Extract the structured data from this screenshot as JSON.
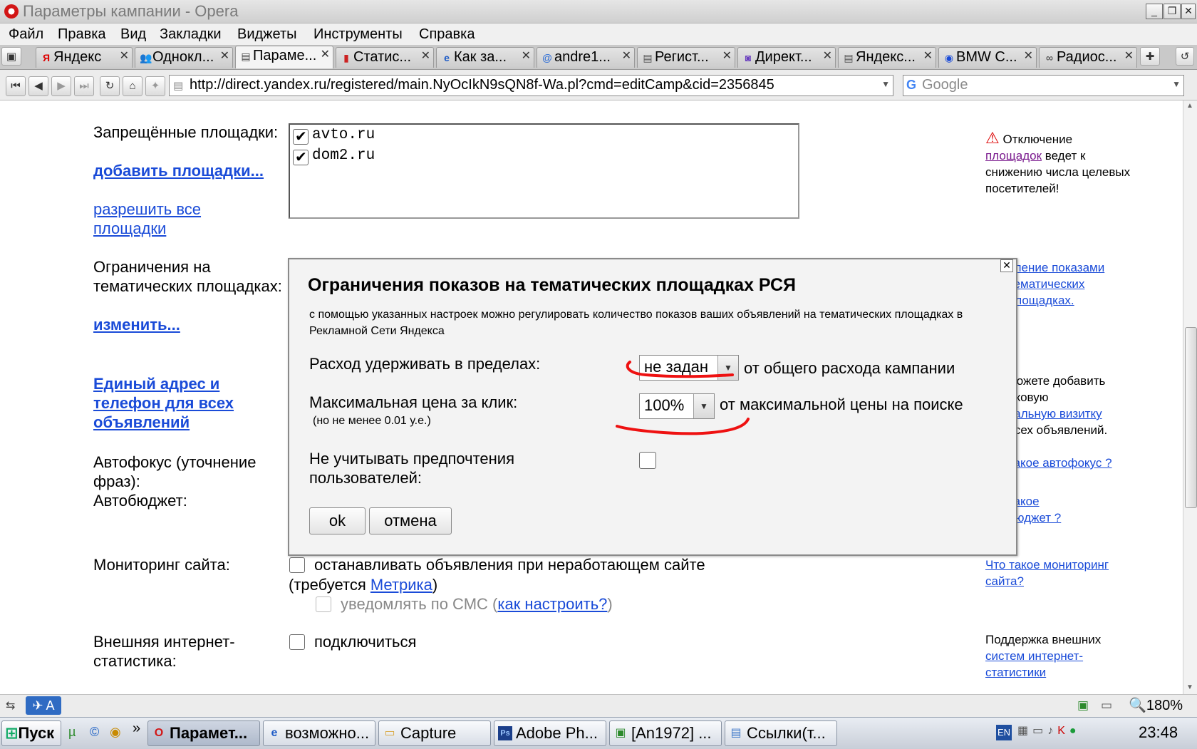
{
  "window": {
    "title": "Параметры кампании - Opera",
    "min_icon": "minimize-icon",
    "max_icon": "maximize-icon",
    "close_icon": "close-icon"
  },
  "menu": [
    "Файл",
    "Правка",
    "Вид",
    "Закладки",
    "Виджеты",
    "Инструменты",
    "Справка"
  ],
  "tabs": [
    {
      "label": "Яндекс",
      "icon": "yandex-icon",
      "glyph": "Я"
    },
    {
      "label": "Однокл...",
      "icon": "odnoklassniki-icon",
      "glyph": "👥"
    },
    {
      "label": "Параме...",
      "icon": "page-icon",
      "glyph": "▤",
      "active": true
    },
    {
      "label": "Статис...",
      "icon": "stats-icon",
      "glyph": "▮"
    },
    {
      "label": "Как за...",
      "icon": "ie-icon",
      "glyph": "e"
    },
    {
      "label": "andre1...",
      "icon": "mail-icon",
      "glyph": "@"
    },
    {
      "label": "Регист...",
      "icon": "document-icon",
      "glyph": "▤"
    },
    {
      "label": "Директ...",
      "icon": "direct-icon",
      "glyph": "◙"
    },
    {
      "label": "Яндекс...",
      "icon": "page-icon",
      "glyph": "▤"
    },
    {
      "label": "BMW C...",
      "icon": "bmw-icon",
      "glyph": "◉"
    },
    {
      "label": "Радиос...",
      "icon": "radio-icon",
      "glyph": "∞"
    }
  ],
  "address": {
    "url": "http://direct.yandex.ru/registered/main.NyOcIkN9sQN8f-Wa.pl?cmd=editCamp&cid=2356845",
    "search_placeholder": "Google"
  },
  "page": {
    "forbidden_label": "Запрещённые площадки:",
    "add_sites_link": "добавить площадки...",
    "allow_all_link": "разрешить все площадки",
    "sites": [
      {
        "name": "avto.ru",
        "checked": true
      },
      {
        "name": "dom2.ru",
        "checked": true
      }
    ],
    "limits_label": "Ограничения на тематических площадках:",
    "change_link": "изменить...",
    "vcard_link": "Единый адрес и телефон для всех объявлений",
    "autofocus_label": "Автофокус (уточнение фраз):",
    "autobudget_label": "Автобюджет:",
    "monitoring_label": "Мониторинг сайта:",
    "monitoring_option": "останавливать объявления при неработающем сайте",
    "monitoring_requires_pre": "(требуется ",
    "metrika_link": "Метрика",
    "monitoring_requires_post": ")",
    "sms_option": "уведомлять по СМС (",
    "how_setup_link": "как настроить?",
    "sms_close": ")",
    "external_label": "Внешняя интернет-статистика:",
    "connect_option": "подключиться"
  },
  "sidebar": {
    "warning_text": "Отключение",
    "warning_link": "площадок",
    "warning_rest": "ведет к снижению числа целевых посетителей!",
    "limits_link": "вление показами тематических площадках.",
    "vcard_text_1": "можете добавить",
    "vcard_text_2": "аковую",
    "vcard_link": "уальную визитку",
    "vcard_text_3": "всех объявлений.",
    "autofocus_link": "такое автофокус ?",
    "autobudget_link_1": "такое",
    "autobudget_link_2": "бюджет ?",
    "monitoring_link": "Что такое мониторинг сайта?",
    "external_text": "Поддержка внешних",
    "external_link": "систем интернет-статистики"
  },
  "dialog": {
    "title": "Ограничения показов на тематических площадках РСЯ",
    "description": "с помощью указанных настроек можно регулировать количество показов ваших объявлений на тематических площадках в Рекламной Сети Яндекса",
    "spend_label": "Расход удерживать в пределах:",
    "spend_value": "не задан",
    "spend_suffix": "от общего расхода кампании",
    "price_label": "Максимальная цена за клик:",
    "price_note": "(но не менее 0.01 у.е.)",
    "price_value": "100%",
    "price_suffix": "от максимальной цены на поиске",
    "ignore_label": "Не учитывать предпочтения пользователей:",
    "ok_label": "ok",
    "cancel_label": "отмена",
    "annotation_color": "#ee1111"
  },
  "statusbar": {
    "zoom": "180%"
  },
  "taskbar": {
    "start_label": "Пуск",
    "tasks": [
      {
        "label": "Парамет...",
        "icon": "opera-icon",
        "glyph": "O",
        "active": true
      },
      {
        "label": "возможно...",
        "icon": "ie-icon",
        "glyph": "e"
      },
      {
        "label": "Capture",
        "icon": "folder-icon",
        "glyph": "▭"
      },
      {
        "label": "Adobe Ph...",
        "icon": "photoshop-icon",
        "glyph": "Ps"
      },
      {
        "label": "[An1972] ...",
        "icon": "chat-icon",
        "glyph": "▣"
      },
      {
        "label": "Ссылки(т...",
        "icon": "notepad-icon",
        "glyph": "▤"
      }
    ],
    "lang": "EN",
    "clock": "23:48"
  }
}
